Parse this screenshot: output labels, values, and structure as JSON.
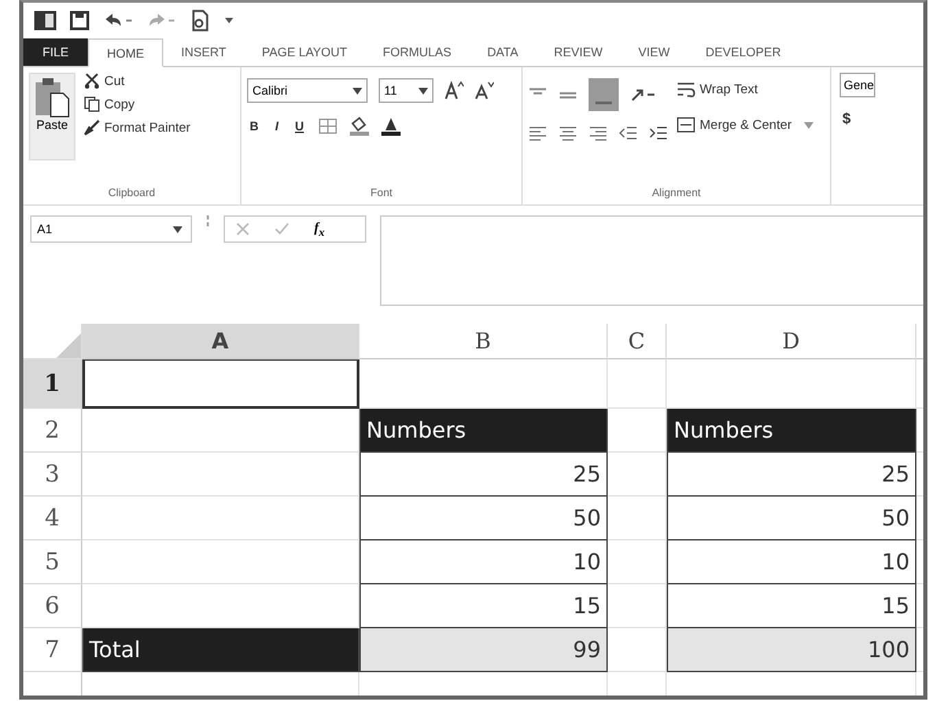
{
  "tabs": [
    {
      "label": "FILE",
      "kind": "file",
      "selected": false
    },
    {
      "label": "HOME",
      "kind": "tab",
      "selected": true
    },
    {
      "label": "INSERT",
      "kind": "tab",
      "selected": false
    },
    {
      "label": "PAGE LAYOUT",
      "kind": "tab",
      "selected": false
    },
    {
      "label": "FORMULAS",
      "kind": "tab",
      "selected": false
    },
    {
      "label": "DATA",
      "kind": "tab",
      "selected": false
    },
    {
      "label": "REVIEW",
      "kind": "tab",
      "selected": false
    },
    {
      "label": "VIEW",
      "kind": "tab",
      "selected": false
    },
    {
      "label": "DEVELOPER",
      "kind": "tab",
      "selected": false
    }
  ],
  "ribbon": {
    "clipboard": {
      "paste": "Paste",
      "cut": "Cut",
      "copy": "Copy",
      "format_painter": "Format Painter",
      "label": "Clipboard"
    },
    "font": {
      "name": "Calibri",
      "size": "11",
      "bold": "B",
      "italic": "I",
      "underline": "U",
      "label": "Font"
    },
    "alignment": {
      "wrap_text": "Wrap Text",
      "merge_center": "Merge & Center",
      "label": "Alignment"
    },
    "number": {
      "format": "Gene",
      "currency": "$"
    }
  },
  "formula_bar": {
    "name_box": "A1",
    "function": "f$_{x}$"
  },
  "columns": [
    {
      "label": "A",
      "selected": true
    },
    {
      "label": "B",
      "selected": false
    },
    {
      "label": "C",
      "selected": false
    },
    {
      "label": "D",
      "selected": false
    }
  ],
  "rows": [
    {
      "number": "1",
      "selected": true,
      "cells": [
        {
          "dark": false,
          "shaded": false,
          "boxed": true,
          "kind": "text",
          "selected": true
        },
        {
          "dark": false,
          "shaded": false,
          "boxed": false,
          "kind": "text",
          "selected": false
        },
        {
          "dark": false,
          "shaded": false,
          "boxed": false,
          "kind": "text",
          "selected": false
        },
        {
          "dark": false,
          "shaded": false,
          "boxed": false,
          "kind": "text",
          "selected": false
        }
      ]
    },
    {
      "number": "2",
      "selected": false,
      "cells": [
        {
          "dark": false,
          "shaded": false,
          "boxed": false,
          "kind": "text",
          "selected": false
        },
        {
          "text": "Numbers",
          "dark": true,
          "shaded": false,
          "boxed": true,
          "kind": "text",
          "selected": false
        },
        {
          "dark": false,
          "shaded": false,
          "boxed": false,
          "kind": "text",
          "selected": false
        },
        {
          "text": "Numbers",
          "dark": true,
          "shaded": false,
          "boxed": true,
          "kind": "text",
          "selected": false
        }
      ]
    },
    {
      "number": "3",
      "selected": false,
      "cells": [
        {
          "dark": false,
          "shaded": false,
          "boxed": false,
          "kind": "text",
          "selected": false
        },
        {
          "text": "25",
          "dark": false,
          "shaded": false,
          "boxed": true,
          "kind": "number",
          "selected": false
        },
        {
          "dark": false,
          "shaded": false,
          "boxed": false,
          "kind": "text",
          "selected": false
        },
        {
          "text": "25",
          "dark": false,
          "shaded": false,
          "boxed": true,
          "kind": "number",
          "selected": false
        }
      ]
    },
    {
      "number": "4",
      "selected": false,
      "cells": [
        {
          "dark": false,
          "shaded": false,
          "boxed": false,
          "kind": "text",
          "selected": false
        },
        {
          "text": "50",
          "dark": false,
          "shaded": false,
          "boxed": true,
          "kind": "number",
          "selected": false
        },
        {
          "dark": false,
          "shaded": false,
          "boxed": false,
          "kind": "text",
          "selected": false
        },
        {
          "text": "50",
          "dark": false,
          "shaded": false,
          "boxed": true,
          "kind": "number",
          "selected": false
        }
      ]
    },
    {
      "number": "5",
      "selected": false,
      "cells": [
        {
          "dark": false,
          "shaded": false,
          "boxed": false,
          "kind": "text",
          "selected": false
        },
        {
          "text": "10",
          "dark": false,
          "shaded": false,
          "boxed": true,
          "kind": "number",
          "selected": false
        },
        {
          "dark": false,
          "shaded": false,
          "boxed": false,
          "kind": "text",
          "selected": false
        },
        {
          "text": "10",
          "dark": false,
          "shaded": false,
          "boxed": true,
          "kind": "number",
          "selected": false
        }
      ]
    },
    {
      "number": "6",
      "selected": false,
      "cells": [
        {
          "dark": false,
          "shaded": false,
          "boxed": false,
          "kind": "text",
          "selected": false
        },
        {
          "text": "15",
          "dark": false,
          "shaded": false,
          "boxed": true,
          "kind": "number",
          "selected": false
        },
        {
          "dark": false,
          "shaded": false,
          "boxed": false,
          "kind": "text",
          "selected": false
        },
        {
          "text": "15",
          "dark": false,
          "shaded": false,
          "boxed": true,
          "kind": "number",
          "selected": false
        }
      ]
    },
    {
      "number": "7",
      "selected": false,
      "cells": [
        {
          "text": "Total",
          "dark": true,
          "shaded": false,
          "boxed": true,
          "kind": "text",
          "selected": false
        },
        {
          "text": "99",
          "dark": false,
          "shaded": true,
          "boxed": true,
          "kind": "number",
          "selected": false
        },
        {
          "dark": false,
          "shaded": false,
          "boxed": false,
          "kind": "text",
          "selected": false
        },
        {
          "text": "100",
          "dark": false,
          "shaded": true,
          "boxed": true,
          "kind": "number",
          "selected": false
        }
      ]
    }
  ]
}
